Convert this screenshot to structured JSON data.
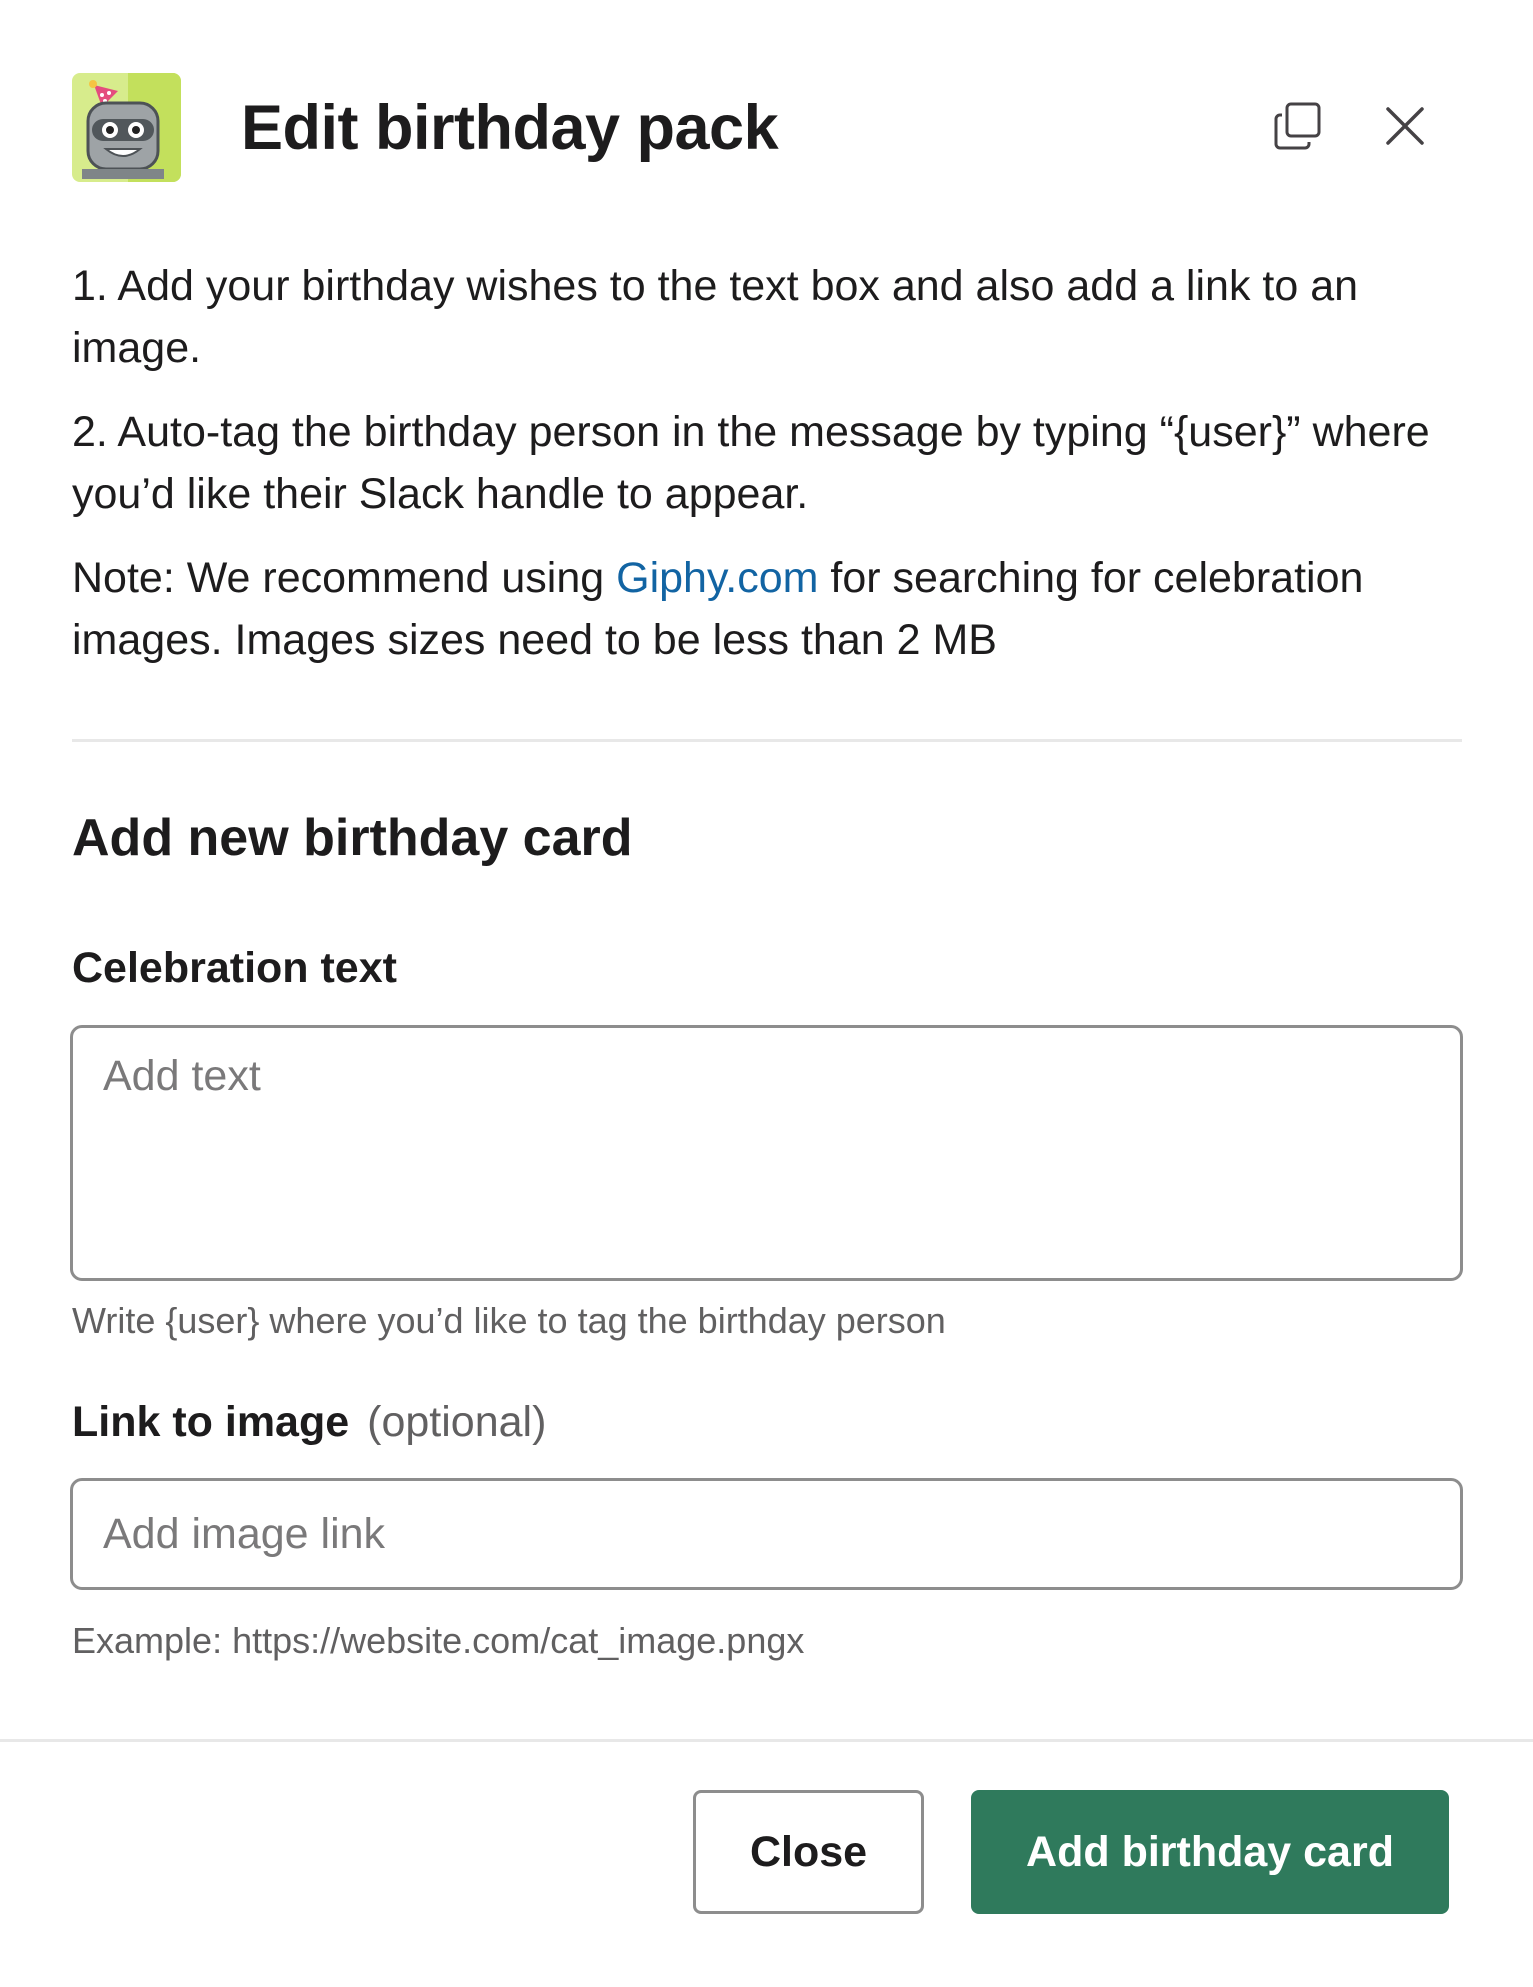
{
  "modal": {
    "title": "Edit birthday pack",
    "icon": "birthday-robot-app-icon",
    "header_actions": {
      "popout_icon": "popout-icon",
      "close_icon": "close-icon"
    }
  },
  "instructions": {
    "step1": "1. Add your birthday wishes to the text box and also add a link to an image.",
    "step2": "2. Auto-tag the birthday person in the message by typing “{user}” where you’d like their Slack handle to appear.",
    "note_prefix": "Note: We recommend using ",
    "note_link": "Giphy.com",
    "note_suffix": " for searching for celebration images. Images sizes need to be less than 2 MB"
  },
  "section": {
    "title": "Add new birthday card"
  },
  "celebration_text": {
    "label": "Celebration text",
    "placeholder": "Add text",
    "value": "",
    "hint": "Write {user} where you’d like to tag the birthday person"
  },
  "image_link": {
    "label": "Link to image",
    "optional": "(optional)",
    "placeholder": "Add image link",
    "value": "",
    "hint": "Example: https://website.com/cat_image.pngx"
  },
  "footer": {
    "close_label": "Close",
    "submit_label": "Add birthday card"
  },
  "colors": {
    "primary_button": "#2f7a5c",
    "link": "#1264a3",
    "border": "#8d8d8d",
    "hint_text": "#616061"
  }
}
